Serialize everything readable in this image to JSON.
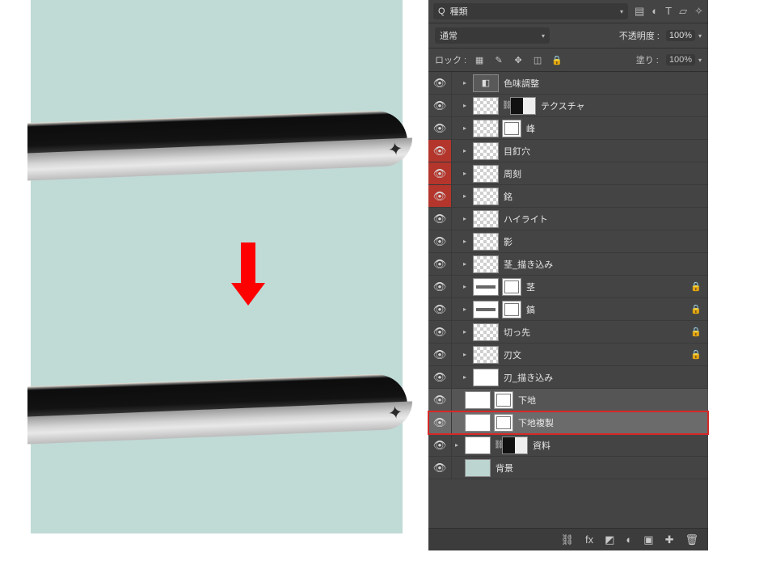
{
  "search": {
    "prefix": "Q",
    "text": "種類"
  },
  "filterIcons": [
    "image-filter-icon",
    "adjust-filter-icon",
    "text-filter-icon",
    "shape-filter-icon",
    "smart-filter-icon"
  ],
  "blend": {
    "mode": "通常",
    "opacityLabel": "不透明度 :",
    "opacityValue": "100%"
  },
  "lock": {
    "label": "ロック :",
    "fillLabel": "塗り :",
    "fillValue": "100%",
    "icons": [
      "lock-pixels-icon",
      "lock-brush-icon",
      "lock-move-icon",
      "lock-artboard-icon",
      "lock-all-icon"
    ]
  },
  "layers": [
    {
      "name": "色味調整",
      "eye": "n",
      "tw": true,
      "thumbs": [
        "adj"
      ],
      "lock": false
    },
    {
      "name": "テクスチャ",
      "eye": "n",
      "tw": true,
      "thumbs": [
        "checker",
        "link",
        "grad"
      ],
      "lock": false
    },
    {
      "name": "峰",
      "eye": "n",
      "tw": true,
      "thumbs": [
        "checker",
        "mask"
      ],
      "lock": false
    },
    {
      "name": "目釘穴",
      "eye": "r",
      "tw": true,
      "thumbs": [
        "checker"
      ],
      "lock": false
    },
    {
      "name": "周刻",
      "eye": "r",
      "tw": true,
      "thumbs": [
        "checker"
      ],
      "lock": false
    },
    {
      "name": "銘",
      "eye": "r",
      "tw": true,
      "thumbs": [
        "checker"
      ],
      "lock": false
    },
    {
      "name": "ハイライト",
      "eye": "n",
      "tw": true,
      "thumbs": [
        "checker"
      ],
      "lock": false
    },
    {
      "name": "影",
      "eye": "n",
      "tw": true,
      "thumbs": [
        "checker"
      ],
      "lock": false
    },
    {
      "name": "茎_描き込み",
      "eye": "n",
      "tw": true,
      "thumbs": [
        "checker"
      ],
      "lock": false
    },
    {
      "name": "茎",
      "eye": "n",
      "tw": true,
      "thumbs": [
        "dotted",
        "mask"
      ],
      "lock": true
    },
    {
      "name": "鎬",
      "eye": "n",
      "tw": true,
      "thumbs": [
        "dotted",
        "mask"
      ],
      "lock": true
    },
    {
      "name": "切っ先",
      "eye": "n",
      "tw": true,
      "thumbs": [
        "checker"
      ],
      "lock": true
    },
    {
      "name": "刃文",
      "eye": "n",
      "tw": true,
      "thumbs": [
        "checker"
      ],
      "lock": true
    },
    {
      "name": "刃_描き込み",
      "eye": "n",
      "tw": true,
      "thumbs": [
        "white"
      ],
      "lock": false
    },
    {
      "name": "下地",
      "eye": "n",
      "tw": false,
      "thumbs": [
        "thumb",
        "mask"
      ],
      "sel": "sel1",
      "lock": false,
      "noind": true
    },
    {
      "name": "下地複製",
      "eye": "n",
      "tw": false,
      "thumbs": [
        "thumb",
        "mask"
      ],
      "sel": "sel2 hl",
      "lock": false,
      "noind": true
    },
    {
      "name": "資料",
      "eye": "n",
      "tw": true,
      "thumbs": [
        "thumb",
        "link",
        "grad"
      ],
      "lock": false,
      "noind": true
    },
    {
      "name": "背景",
      "eye": "n",
      "tw": false,
      "thumbs": [
        "solid"
      ],
      "lock": false,
      "noind": true
    }
  ],
  "footer": [
    "link-icon",
    "fx-icon",
    "mask-new-icon",
    "adjustment-new-icon",
    "group-new-icon",
    "layer-new-icon",
    "trash-icon"
  ]
}
